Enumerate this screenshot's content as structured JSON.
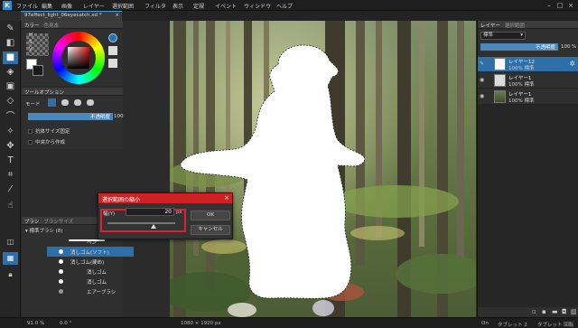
{
  "menu": {
    "items": [
      "ファイル",
      "編集",
      "画像",
      "レイヤー",
      "選択範囲",
      "フィルタ",
      "表示",
      "定規",
      "イベント",
      "ウィンドウ",
      "ヘルプ"
    ]
  },
  "document_tab": {
    "title": "97effect_light_06eyecatch.xd *"
  },
  "color_panel": {
    "tab_active": "カラー",
    "tab_inactive": "色見本",
    "h_label": "H",
    "s_label": "S",
    "v_label": "V"
  },
  "tool_options": {
    "header": "ツールオプション",
    "mode_label": "モード",
    "opacity_label": "不透明度",
    "opacity_value": "100",
    "opacity_unit": "%",
    "check1": "抗体サイズ固定",
    "check2": "中央から作成"
  },
  "brush_panel": {
    "tab_active": "ブラシ",
    "tab_inactive": "ブラシサイズ",
    "set_name": "標準ブラシ (8)",
    "items": [
      "ペン",
      "消しゴム(ソフト)",
      "消しゴム(硬め)",
      "消しゴム",
      "消しゴム",
      "エアーブラシ"
    ]
  },
  "dialog": {
    "title": "選択範囲の縮小",
    "width_label": "幅(Y)",
    "width_value": "20",
    "unit": "px",
    "ok_label": "OK",
    "cancel_label": "キャンセル"
  },
  "layers": {
    "tab_active": "レイヤー",
    "tab_inactive": "選択範囲",
    "blend_mode": "標準",
    "opacity_label": "不透明度",
    "opacity_value": "100",
    "opacity_unit": "%",
    "rows": [
      {
        "name": "レイヤー12",
        "mode": "100% 標準",
        "selected": true
      },
      {
        "name": "レイヤー1",
        "mode": "100% 標準",
        "selected": false
      },
      {
        "name": "レイヤー1",
        "mode": "100% 標準",
        "selected": false
      }
    ]
  },
  "status": {
    "zoom": "91.0 %",
    "angle": "0.0 °",
    "size": "1080 × 1920 px",
    "pen": "On",
    "tablet1": "タブレット 2",
    "tablet2": "タブレット 回転"
  },
  "colors": {
    "accent": "#2d6fa8",
    "dialog_title": "#cf2024",
    "highlight_box": "#e0202a"
  }
}
